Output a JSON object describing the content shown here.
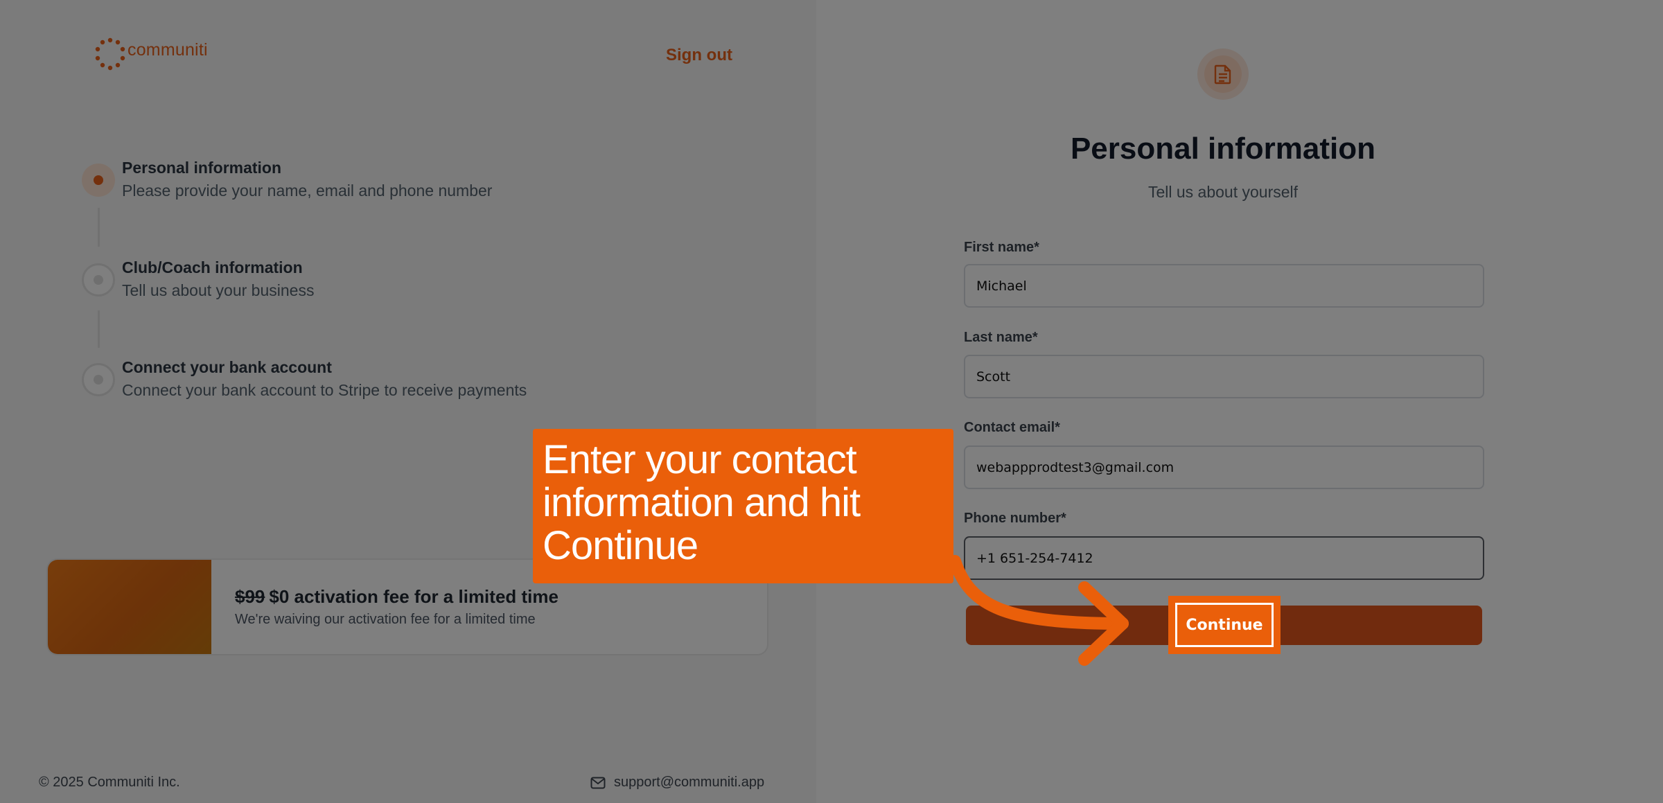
{
  "brand": {
    "name": "communiti",
    "accent": "#e8611a"
  },
  "header": {
    "sign_out": "Sign out"
  },
  "steps": [
    {
      "title": "Personal information",
      "description": "Please provide your name, email and phone number",
      "state": "active"
    },
    {
      "title": "Club/Coach information",
      "description": "Tell us about your business",
      "state": "pending"
    },
    {
      "title": "Connect your bank account",
      "description": "Connect your bank account to Stripe to receive payments",
      "state": "pending"
    }
  ],
  "promo": {
    "old_price": "$99",
    "title_rest": "$0 activation fee for a limited time",
    "subtitle": "We're waiving our activation fee for a limited time"
  },
  "footer": {
    "copyright": "© 2025 Communiti Inc.",
    "support_email": "support@communiti.app"
  },
  "form": {
    "icon": "document-icon",
    "title": "Personal information",
    "subtitle": "Tell us about yourself",
    "fields": {
      "first_name": {
        "label": "First name*",
        "value": "Michael"
      },
      "last_name": {
        "label": "Last name*",
        "value": "Scott"
      },
      "email": {
        "label": "Contact email*",
        "value": "webappprodtest3@gmail.com"
      },
      "phone": {
        "label": "Phone number*",
        "value": "+1 651-254-7412"
      }
    },
    "continue_label": "Continue"
  },
  "annotation": {
    "callout_text": "Enter your contact information and hit Continue",
    "highlight_label": "Continue",
    "color": "#ea5f0a"
  }
}
